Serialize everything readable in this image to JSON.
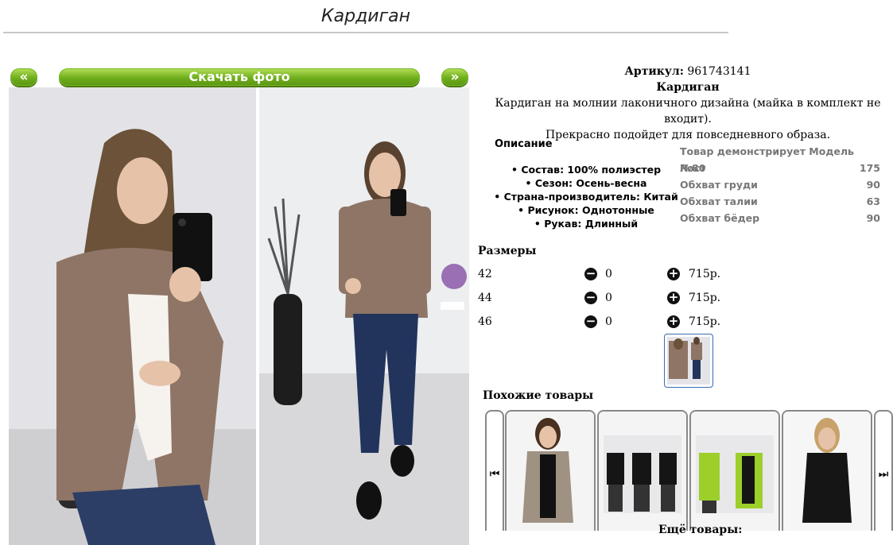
{
  "page": {
    "title": "Кардиган"
  },
  "gallery": {
    "prev_label": "«",
    "download_label": "Скачать фото",
    "next_label": "»"
  },
  "product": {
    "sku_label": "Артикул:",
    "sku_value": "961743141",
    "name": "Кардиган",
    "description_line1": "Кардиган на молнии лаконичного дизайна (майка в комплект не входит).",
    "description_line2": "Прекрасно подойдет для повседневного образа."
  },
  "description": {
    "title": "Описание",
    "items": [
      "Состав: 100% полиэстер",
      "Сезон: Осень-весна",
      "Страна-производитель: Китай",
      "Рисунок: Однотонные",
      "Рукав: Длинный"
    ]
  },
  "model": {
    "rows": [
      {
        "label": "Товар демонстрирует Модель №80",
        "value": ""
      },
      {
        "label": "Рост",
        "value": "175"
      },
      {
        "label": "Обхват груди",
        "value": "90"
      },
      {
        "label": "Обхват талии",
        "value": "63"
      },
      {
        "label": "Обхват бёдер",
        "value": "90"
      }
    ]
  },
  "sizes": {
    "title": "Размеры",
    "rows": [
      {
        "size": "42",
        "qty": "0",
        "price": "715р."
      },
      {
        "size": "44",
        "qty": "0",
        "price": "715р."
      },
      {
        "size": "46",
        "qty": "0",
        "price": "715р."
      }
    ]
  },
  "similar": {
    "title": "Похожие товары"
  },
  "more": {
    "title": "Ещё товары:"
  },
  "colors": {
    "button_green": "#6fae1c",
    "thumb_border": "#3a6cb0",
    "model_text": "#777777",
    "link_green": "#2a8a1a"
  }
}
